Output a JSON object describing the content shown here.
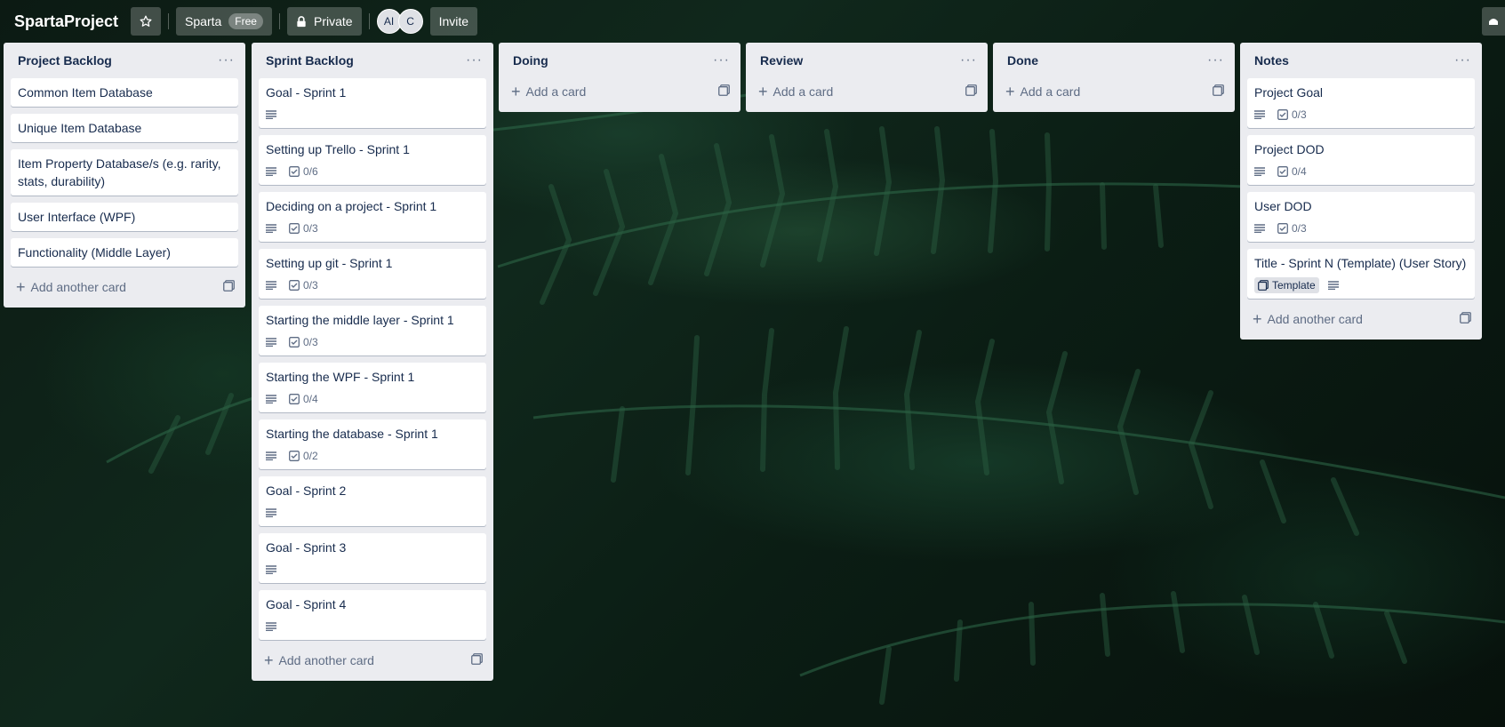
{
  "board": {
    "title": "SpartaProject",
    "workspace": "Sparta",
    "plan_badge": "Free",
    "visibility": "Private",
    "invite_label": "Invite",
    "members": [
      "AI",
      "C"
    ]
  },
  "lists": [
    {
      "name": "Project Backlog",
      "cards": [
        {
          "title": "Common Item Database"
        },
        {
          "title": "Unique Item Database"
        },
        {
          "title": "Item Property Database/s (e.g. rarity, stats, durability)"
        },
        {
          "title": "User Interface (WPF)"
        },
        {
          "title": "Functionality (Middle Layer)"
        }
      ],
      "add_label": "Add another card"
    },
    {
      "name": "Sprint Backlog",
      "cards": [
        {
          "title": "Goal - Sprint 1",
          "description": true
        },
        {
          "title": "Setting up Trello - Sprint 1",
          "description": true,
          "checklist": "0/6"
        },
        {
          "title": "Deciding on a project - Sprint 1",
          "description": true,
          "checklist": "0/3"
        },
        {
          "title": "Setting up git - Sprint 1",
          "description": true,
          "checklist": "0/3"
        },
        {
          "title": "Starting the middle layer - Sprint 1",
          "description": true,
          "checklist": "0/3"
        },
        {
          "title": "Starting the WPF - Sprint 1",
          "description": true,
          "checklist": "0/4"
        },
        {
          "title": "Starting the database - Sprint 1",
          "description": true,
          "checklist": "0/2"
        },
        {
          "title": "Goal - Sprint 2",
          "description": true
        },
        {
          "title": "Goal - Sprint 3",
          "description": true
        },
        {
          "title": "Goal - Sprint 4",
          "description": true
        }
      ],
      "add_label": "Add another card"
    },
    {
      "name": "Doing",
      "cards": [],
      "add_label": "Add a card"
    },
    {
      "name": "Review",
      "cards": [],
      "add_label": "Add a card"
    },
    {
      "name": "Done",
      "cards": [],
      "add_label": "Add a card"
    },
    {
      "name": "Notes",
      "cards": [
        {
          "title": "Project Goal",
          "description": true,
          "checklist": "0/3"
        },
        {
          "title": "Project DOD",
          "description": true,
          "checklist": "0/4"
        },
        {
          "title": "User DOD",
          "description": true,
          "checklist": "0/3"
        },
        {
          "title": "Title - Sprint N (Template) (User Story)",
          "template": "Template",
          "description": true
        }
      ],
      "add_label": "Add another card"
    }
  ],
  "colors": {
    "list_bg": "#ebecf0",
    "card_bg": "#ffffff",
    "text": "#172b4d",
    "muted": "#5e6c84"
  }
}
